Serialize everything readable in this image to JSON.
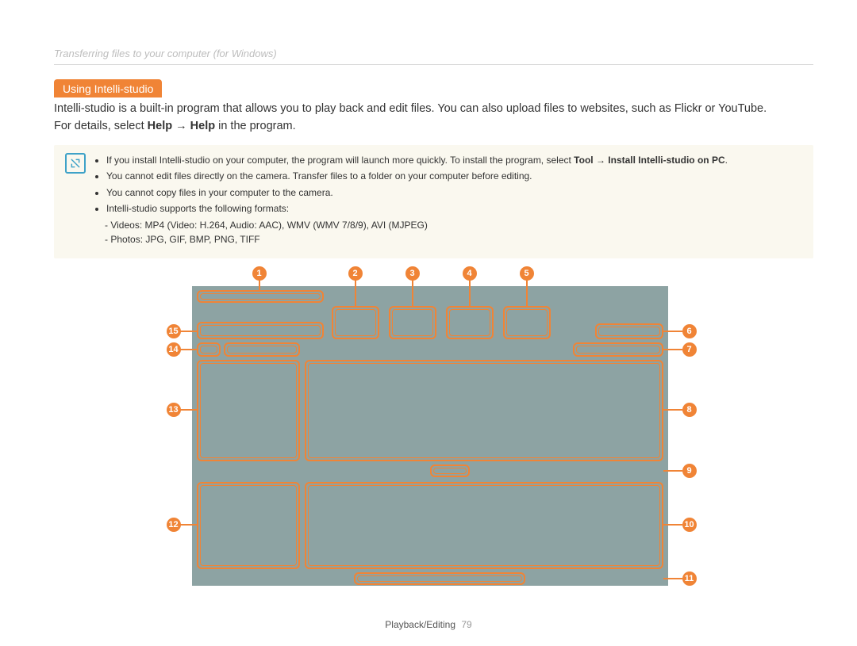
{
  "header": {
    "title": "Transferring files to your computer (for Windows)"
  },
  "section": {
    "title": "Using Intelli-studio"
  },
  "intro": {
    "text_a": "Intelli-studio is a built-in program that allows you to play back and edit files. You can also upload files to websites, such as Flickr or YouTube.",
    "text_b_pre": "For details, select ",
    "text_b_bold1": "Help",
    "text_b_arrow": " → ",
    "text_b_bold2": "Help",
    "text_b_post": " in the program."
  },
  "notes": {
    "b1_pre": "If you install Intelli-studio on your computer, the program will launch more quickly. To install the program, select ",
    "b1_bold": "Tool → Install Intelli-studio on PC",
    "b1_post": ".",
    "b2": "You cannot edit files directly on the camera. Transfer files to a folder on your computer before editing.",
    "b3": "You cannot copy files in your computer to the camera.",
    "b4": "Intelli-studio supports the following formats:",
    "b4a": "Videos: MP4 (Video: H.264, Audio: AAC), WMV (WMV 7/8/9), AVI (MJPEG)",
    "b4b": "Photos: JPG, GIF, BMP, PNG, TIFF"
  },
  "callouts": {
    "c1": "1",
    "c2": "2",
    "c3": "3",
    "c4": "4",
    "c5": "5",
    "c6": "6",
    "c7": "7",
    "c8": "8",
    "c9": "9",
    "c10": "10",
    "c11": "11",
    "c12": "12",
    "c13": "13",
    "c14": "14",
    "c15": "15"
  },
  "footer": {
    "section": "Playback/Editing",
    "page": "79"
  }
}
